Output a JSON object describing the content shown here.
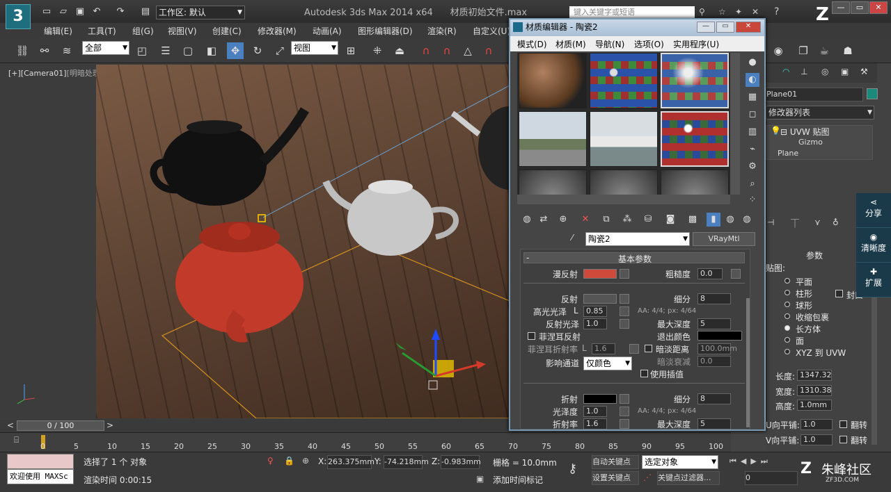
{
  "app": {
    "title": "Autodesk 3ds Max  2014 x64",
    "file": "材质初始文件.max",
    "logo": "3",
    "workspace": "工作区: 默认",
    "search_placeholder": "键入关键字或短语"
  },
  "menu": [
    "编辑(E)",
    "工具(T)",
    "组(G)",
    "视图(V)",
    "创建(C)",
    "修改器(M)",
    "动画(A)",
    "图形编辑器(D)",
    "渲染(R)",
    "自定义(U)"
  ],
  "toolbar": {
    "selection_filter": "全部",
    "ref_coord": "视图"
  },
  "viewport": {
    "label_prefix": "[+]",
    "label_camera": "[Camera01]",
    "label_shading": "[明暗处理]"
  },
  "timeline": {
    "frame": "0 / 100",
    "prev": "<",
    "next": ">",
    "ticks": [
      "0",
      "5",
      "10",
      "15",
      "20",
      "25",
      "30",
      "35",
      "40",
      "45",
      "50",
      "55",
      "60",
      "65",
      "70",
      "75",
      "80",
      "85",
      "90",
      "95",
      "100"
    ]
  },
  "status": {
    "welcome": "欢迎使用 MAXSc",
    "selected": "选择了 1 个 对象",
    "render_time": "渲染时间  0:00:15",
    "x_label": "X:",
    "x": "263.375mm",
    "y_label": "Y:",
    "y": "-74.218mm",
    "z_label": "Z:",
    "z": "-0.983mm",
    "grid": "栅格 = 10.0mm",
    "add_time_tag": "添加时间标记",
    "auto_key": "自动关键点",
    "set_key": "设置关键点",
    "selected_obj": "选定对象",
    "key_filter": "关键点过滤器...",
    "frame_field": "0"
  },
  "material_editor": {
    "title": "材质编辑器 - 陶瓷2",
    "menu": [
      "模式(D)",
      "材质(M)",
      "导航(N)",
      "选项(O)",
      "实用程序(U)"
    ],
    "material_name": "陶瓷2",
    "material_type": "VRayMtl",
    "rollout_title": "基本参数",
    "rollout_toggle": "-",
    "diffuse_label": "漫反射",
    "roughness_label": "粗糙度",
    "roughness": "0.0",
    "diffuse_color": "#d04a3c",
    "reflect_label": "反射",
    "subdiv_label": "细分",
    "reflect_subdiv": "8",
    "hilight_label": "高光光泽",
    "hilight_l": "L",
    "hilight": "0.85",
    "aa_note": "AA: 4/4; px: 4/64",
    "refl_gloss_label": "反射光泽",
    "refl_gloss": "1.0",
    "max_depth_label": "最大深度",
    "max_depth": "5",
    "fresnel_label": "菲涅耳反射",
    "exit_color_label": "退出颜色",
    "fresnel_ior_label": "菲涅耳折射率",
    "fresnel_ior_l": "L",
    "fresnel_ior": "1.6",
    "dim_dist_label": "暗淡距离",
    "dim_dist": "100.0mm",
    "affect_label": "影响通道",
    "affect_value": "仅颜色",
    "dim_falloff_label": "暗淡衰减",
    "dim_falloff": "0.0",
    "use_interp_label": "使用插值",
    "refract_label": "折射",
    "refract_subdiv": "8",
    "gloss_label": "光泽度",
    "gloss": "1.0",
    "aa_note2": "AA: 4/4; px: 4/64",
    "ior_label": "折射率",
    "ior": "1.6",
    "refract_max_depth": "5"
  },
  "command_panel": {
    "object_name": "Plane01",
    "modifier_list": "修改器列表",
    "stack": [
      "UVW 贴图",
      "Gizmo",
      "Plane"
    ],
    "params_title": "参数",
    "mapping_label": "贴图:",
    "mapping": [
      "平面",
      "柱形",
      "球形",
      "收缩包裹",
      "长方体",
      "面",
      "XYZ 到 UVW"
    ],
    "cap_label": "封口",
    "length_label": "长度:",
    "length": "1347.32",
    "width_label": "宽度:",
    "width": "1310.38",
    "height_label": "高度:",
    "height": "1.0mm",
    "u_tile_label": "U向平铺:",
    "u_tile": "1.0",
    "v_tile_label": "V向平铺:",
    "v_tile": "1.0",
    "flip": "翻转"
  },
  "share": {
    "share": "分享",
    "clarity": "清晰度",
    "expand": "扩展"
  },
  "watermark": {
    "text": "朱峰社区",
    "sub": "ZF3D.COM"
  }
}
